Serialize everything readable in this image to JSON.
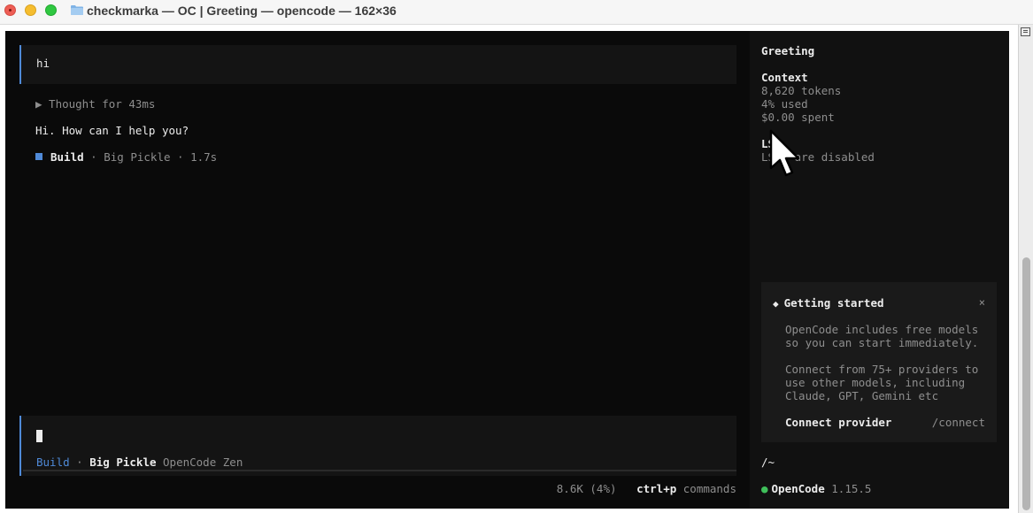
{
  "window": {
    "title": "checkmarka — OC | Greeting — opencode — 162×36"
  },
  "conversation": {
    "user_message": "hi",
    "thought": "▶ Thought for 43ms",
    "reply": "Hi. How can I help you?",
    "build": {
      "agent": "Build",
      "model": "Big Pickle",
      "duration": "1.7s",
      "separator": "·"
    }
  },
  "input": {
    "agent": "Build",
    "separator": "·",
    "model": "Big Pickle",
    "provider": "OpenCode Zen"
  },
  "footer": {
    "usage": "8.6K (4%)",
    "shortcut_key": "ctrl+p",
    "shortcut_label": "commands"
  },
  "sidebar": {
    "session_title": "Greeting",
    "context": {
      "heading": "Context",
      "tokens": "8,620 tokens",
      "used": "4% used",
      "spent": "$0.00 spent"
    },
    "lsp": {
      "heading": "LSP",
      "status": "LSPs are disabled"
    },
    "getting_started": {
      "title": "Getting started",
      "close": "×",
      "line1": "OpenCode includes free models",
      "line2": "so you can start immediately.",
      "line3": "Connect from 75+ providers to",
      "line4": "use other models, including",
      "line5": "Claude, GPT, Gemini etc",
      "connect_label": "Connect provider",
      "connect_cmd": "/connect"
    },
    "path": "/~",
    "app_name": "OpenCode",
    "app_version": "1.15.5"
  },
  "colors": {
    "accent": "#4f8ad8",
    "status_dot": "#3fbf5a",
    "background": "#0a0a0a"
  }
}
